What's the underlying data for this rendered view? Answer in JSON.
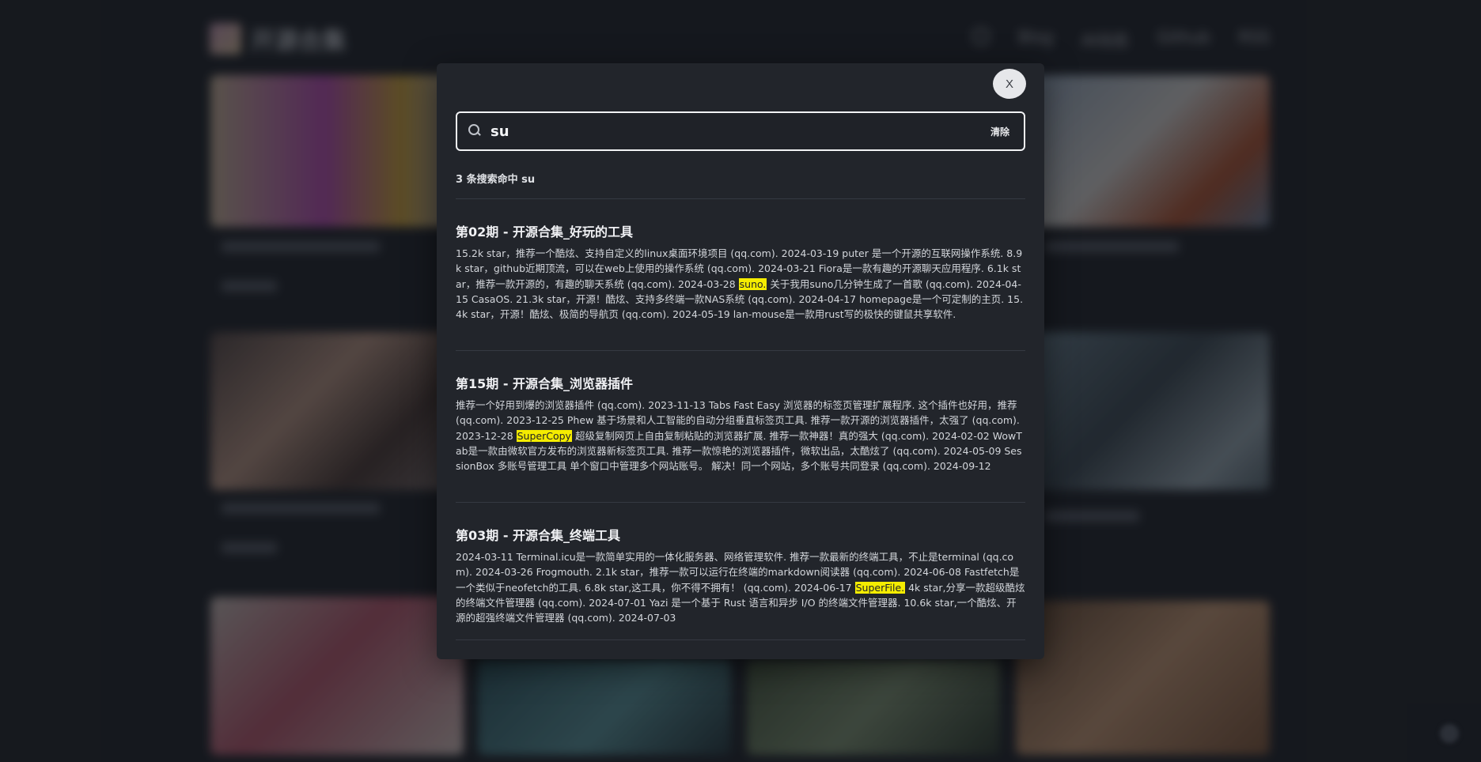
{
  "background": {
    "site_title": "开源合集",
    "nav": [
      "Blog",
      "AI动态",
      "Github",
      "RSS"
    ]
  },
  "modal": {
    "close_label": "X",
    "search": {
      "value": "su",
      "placeholder": "",
      "clear_label": "清除"
    },
    "summary": "3 条搜索命中 su",
    "results": [
      {
        "title": "第02期 - 开源合集_好玩的工具",
        "before": "15.2k star，推荐一个酷炫、支持自定义的linux桌面环境项目 (qq.com). 2024-03-19 puter 是一个开源的互联网操作系统. 8.9k star，github近期顶流，可以在web上使用的操作系统 (qq.com). 2024-03-21 Fiora是一款有趣的开源聊天应用程序. 6.1k star，推荐一款开源的，有趣的聊天系统 (qq.com). 2024-03-28 ",
        "match": "suno.",
        "after": " 关于我用suno几分钟生成了一首歌 (qq.com). 2024-04-15 CasaOS. 21.3k star，开源！酷炫、支持多终端一款NAS系统 (qq.com). 2024-04-17 homepage是一个可定制的主页. 15.4k star，开源！酷炫、极简的导航页 (qq.com). 2024-05-19 lan-mouse是一款用rust写的极快的键鼠共享软件."
      },
      {
        "title": "第15期 - 开源合集_浏览器插件",
        "before": "推荐一个好用到爆的浏览器插件 (qq.com). 2023-11-13 Tabs Fast Easy 浏览器的标签页管理扩展程序. 这个插件也好用，推荐 (qq.com). 2023-12-25 Phew 基于场景和人工智能的自动分组垂直标签页工具. 推荐一款开源的浏览器插件，太强了 (qq.com). 2023-12-28 ",
        "match": "SuperCopy",
        "after": " 超级复制网页上自由复制粘贴的浏览器扩展. 推荐一款神器！真的强大 (qq.com). 2024-02-02 WowTab是一款由微软官方发布的浏览器新标签页工具. 推荐一款惊艳的浏览器插件，微软出品，太酷炫了 (qq.com). 2024-05-09 SessionBox 多账号管理工具 单个窗口中管理多个网站账号。 解决！同一个网站，多个账号共同登录 (qq.com). 2024-09-12"
      },
      {
        "title": "第03期 - 开源合集_终端工具",
        "before": "2024-03-11 Terminal.icu是一款简单实用的一体化服务器、网络管理软件. 推荐一款最新的终端工具，不止是terminal (qq.com). 2024-03-26 Frogmouth. 2.1k star，推荐一款可以运行在终端的markdown阅读器 (qq.com). 2024-06-08 Fastfetch是一个类似于neofetch的工具. 6.8k star,这工具，你不得不拥有！ (qq.com). 2024-06-17 ",
        "match": "SuperFile.",
        "after": " 4k star,分享一款超级酷炫的终端文件管理器 (qq.com). 2024-07-01 Yazi 是一个基于 Rust 语言和异步 I/O 的终端文件管理器. 10.6k star,一个酷炫、开源的超强终端文件管理器 (qq.com). 2024-07-03"
      }
    ]
  },
  "colors": {
    "page_bg": "#1d2026",
    "modal_bg": "#22252b",
    "highlight": "#f5ec00",
    "close_button_bg": "#e6e7ea"
  }
}
